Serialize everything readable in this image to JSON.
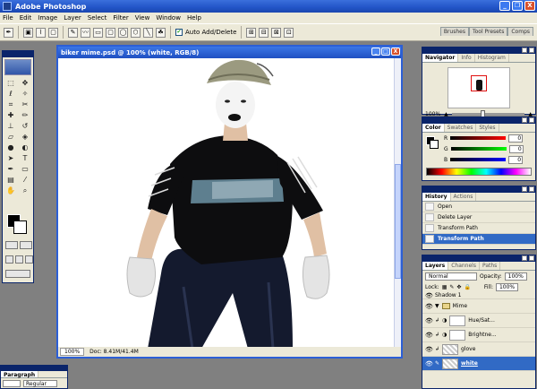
{
  "app": {
    "title": "Adobe Photoshop",
    "win_min": "_",
    "win_max": "❐",
    "win_close": "X"
  },
  "menu": [
    "File",
    "Edit",
    "Image",
    "Layer",
    "Select",
    "Filter",
    "View",
    "Window",
    "Help"
  ],
  "options": {
    "auto_add_delete_label": "Auto Add/Delete",
    "auto_add_delete_checked": true
  },
  "palette_well": [
    "Brushes",
    "Tool Presets",
    "Comps"
  ],
  "document": {
    "title": "biker mime.psd @ 100% (white, RGB/8)",
    "zoom": "100%",
    "doc_size": "Doc: 8.41M/41.4M",
    "close_label": "X",
    "min_label": "_",
    "max_label": "□"
  },
  "navigator": {
    "tabs": [
      "Navigator",
      "Info",
      "Histogram"
    ],
    "zoom": "100%"
  },
  "color": {
    "tabs": [
      "Color",
      "Swatches",
      "Styles"
    ],
    "channels": [
      {
        "label": "R",
        "value": "0",
        "gradient": "#000000,#ff0000"
      },
      {
        "label": "G",
        "value": "0",
        "gradient": "#000000,#00ff00"
      },
      {
        "label": "B",
        "value": "0",
        "gradient": "#000000,#0000ff"
      }
    ]
  },
  "history": {
    "tabs": [
      "History",
      "Actions"
    ],
    "items": [
      "Open",
      "Delete Layer",
      "Transform Path",
      "Transform Path"
    ],
    "selected_index": 3
  },
  "layers": {
    "tabs": [
      "Layers",
      "Channels",
      "Paths"
    ],
    "blend_mode": "Normal",
    "opacity_label": "Opacity:",
    "opacity": "100%",
    "lock_label": "Lock:",
    "fill_label": "Fill:",
    "fill": "100%",
    "rows": [
      {
        "name": "Shadow 1",
        "kind": "partial"
      },
      {
        "name": "Mime",
        "kind": "group"
      },
      {
        "name": "Hue/Sat...",
        "kind": "adjust"
      },
      {
        "name": "Brightne...",
        "kind": "adjust"
      },
      {
        "name": "glove",
        "kind": "layer"
      },
      {
        "name": "white",
        "kind": "layer",
        "selected": true
      }
    ]
  },
  "character": {
    "tabs": [
      "Paragraph"
    ],
    "font_style": "Regular"
  }
}
